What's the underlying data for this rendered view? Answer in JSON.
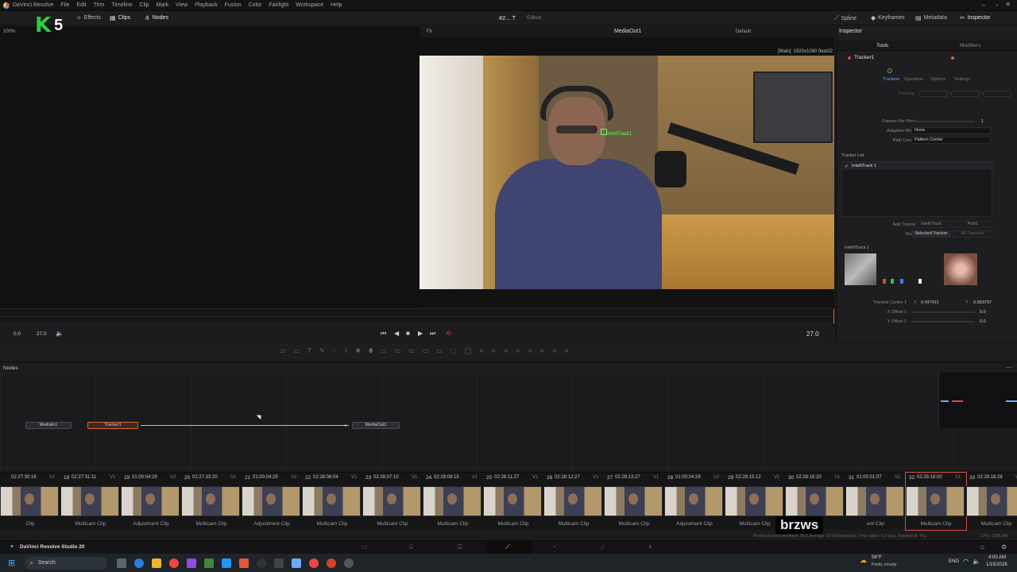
{
  "menubar": {
    "app": "DaVinci Resolve",
    "items": [
      "File",
      "Edit",
      "Trim",
      "Timeline",
      "Clip",
      "Mark",
      "View",
      "Playback",
      "Fusion",
      "Color",
      "Fairlight",
      "Workspace",
      "Help"
    ]
  },
  "toolbar": {
    "left": [
      "Effects",
      "Clips",
      "Nodes"
    ],
    "zoom": "100%",
    "overlay_badge": "5",
    "title": "#2... T",
    "title_status": "Edited",
    "right": [
      "Spline",
      "Keyframes",
      "Metadata",
      "Inspector"
    ]
  },
  "viewer": {
    "fit": "Fit",
    "name": "MediaOut1",
    "lut": "Default",
    "resolution": "[Main]: 1920x1080 float32",
    "track_label": "IntelliTrack1"
  },
  "inspector": {
    "title": "Inspector",
    "tabs": [
      "Tools",
      "Modifiers"
    ],
    "tool_name": "Tracker1",
    "subtabs": [
      "Trackers",
      "Operation",
      "Options",
      "Settings"
    ],
    "tracking_label": "Tracking",
    "frames_per_point_label": "Frames Per Point",
    "frames_per_point_value": "1",
    "adaptive_mode_label": "Adaptive Mode",
    "adaptive_mode_value": "None",
    "path_center_label": "Path Center",
    "path_center_value": "Pattern Center",
    "tracker_list_label": "Tracker List",
    "tracker_item": "IntelliTrack 1",
    "add_tracker_label": "Add Tracker",
    "add_tracker_options": [
      "IntelliTrack",
      "Point"
    ],
    "show_label": "Show",
    "show_options": [
      "Selected Tracker",
      "All Trackers"
    ],
    "section_title": "IntelliTrack 1",
    "tracked_center_label": "Tracked Center 1",
    "x_label": "X",
    "x_value": "0.437411",
    "y_label": "Y",
    "y_value": "0.683797",
    "x_offset_label": "X Offset 1",
    "x_offset_value": "0.0",
    "y_offset_label": "Y Offset 1",
    "y_offset_value": "0.0"
  },
  "transport": {
    "start": "0.0",
    "end": "27.0",
    "current": "27.0"
  },
  "nodes": {
    "header": "Nodes",
    "items": [
      "MediaIn1",
      "Tracker1",
      "MediaOut1"
    ]
  },
  "clips": [
    {
      "num": "",
      "tc": "02:27:30:16",
      "trk": "V1",
      "name": "Clip"
    },
    {
      "num": "18",
      "tc": "02:27:31:11",
      "trk": "V1",
      "name": "Multicam Clip"
    },
    {
      "num": "19",
      "tc": "01:00:04:29",
      "trk": "V2",
      "name": "Adjustment Clip"
    },
    {
      "num": "20",
      "tc": "02:27:33:20",
      "trk": "V1",
      "name": "Multicam Clip"
    },
    {
      "num": "21",
      "tc": "01:00:04:29",
      "trk": "V2",
      "name": "Adjustment Clip"
    },
    {
      "num": "22",
      "tc": "02:28:06:04",
      "trk": "V1",
      "name": "Multicam Clip"
    },
    {
      "num": "23",
      "tc": "02:28:07:10",
      "trk": "V1",
      "name": "Multicam Clip"
    },
    {
      "num": "24",
      "tc": "02:28:08:15",
      "trk": "V1",
      "name": "Multicam Clip"
    },
    {
      "num": "25",
      "tc": "02:28:11:27",
      "trk": "V1",
      "name": "Multicam Clip"
    },
    {
      "num": "26",
      "tc": "02:28:12:27",
      "trk": "V1",
      "name": "Multicam Clip"
    },
    {
      "num": "27",
      "tc": "02:28:13:27",
      "trk": "V1",
      "name": "Multicam Clip"
    },
    {
      "num": "28",
      "tc": "01:00:04:29",
      "trk": "V2",
      "name": "Adjustment Clip"
    },
    {
      "num": "29",
      "tc": "02:28:15:12",
      "trk": "V1",
      "name": "Multicam Clip"
    },
    {
      "num": "30",
      "tc": "02:28:16:20",
      "trk": "V1",
      "name": ""
    },
    {
      "num": "31",
      "tc": "01:00:01:07",
      "trk": "V2",
      "name": "ent Clip"
    },
    {
      "num": "32",
      "tc": "02:28:18:00",
      "trk": "V1",
      "name": "Multicam Clip"
    },
    {
      "num": "33",
      "tc": "02:28:18:28",
      "trk": "V1",
      "name": "Multicam Clip"
    }
  ],
  "pagebar": {
    "app_name": "DaVinci Resolve Studio 20",
    "status": "Preview frames rendered: 28.0,  Average: 22.59 frames/sec,  Time taken: 1.2 secs,  Finished at: Thu",
    "memory": "17% - 5396 MB"
  },
  "watermark": "brzws",
  "taskbar": {
    "search": "Search",
    "weather_temp": "56°F",
    "weather_desc": "Partly cloudy",
    "lang": "ENG",
    "time": "4:00 AM",
    "date": "1/15/2026"
  },
  "colors": {
    "accent_orange": "#e3652b",
    "node_connection": "#e2c34b",
    "selected_red": "#d24a4a",
    "badge_green": "#2ecc40"
  }
}
